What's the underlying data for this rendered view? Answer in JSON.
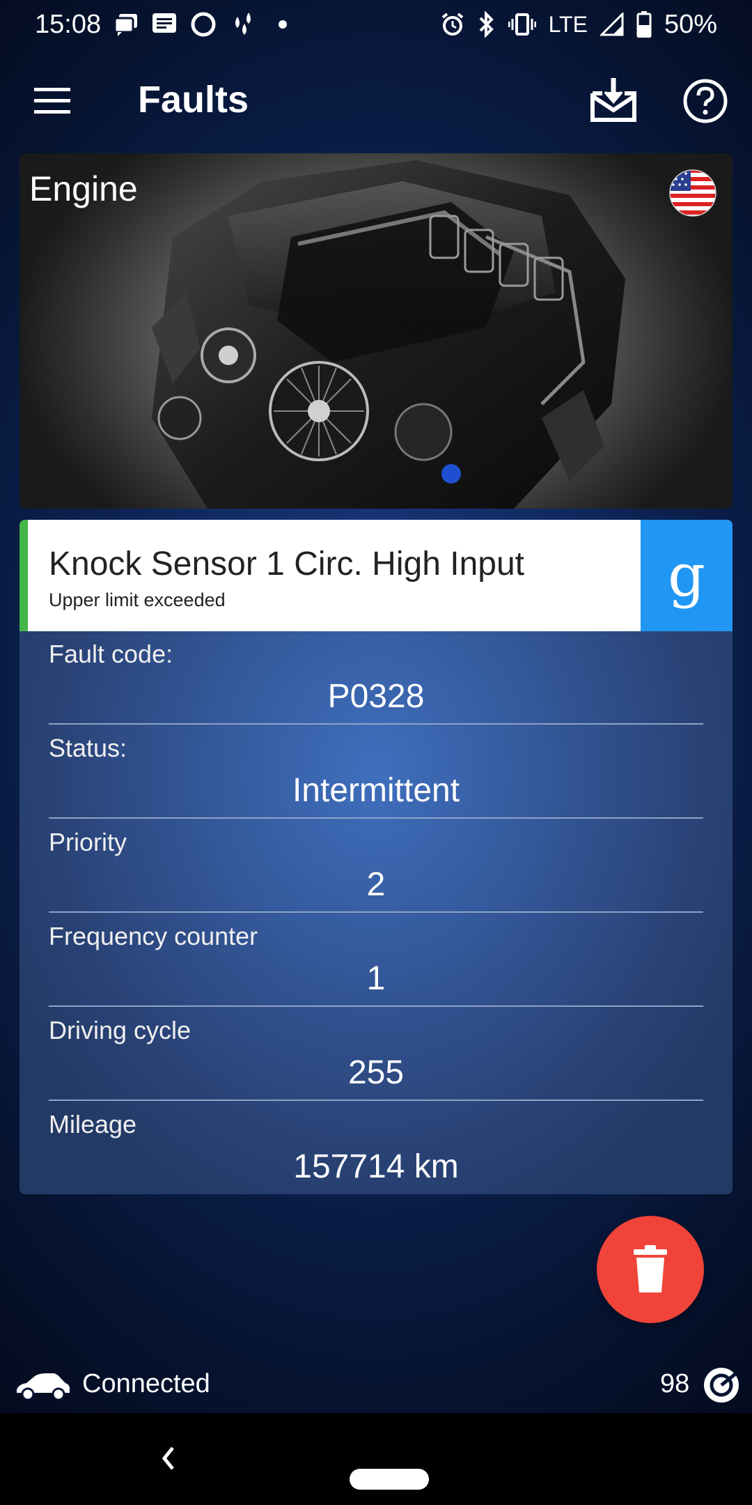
{
  "status_bar": {
    "time": "15:08",
    "network": "LTE",
    "battery": "50%",
    "icons": [
      "chat-icon",
      "message-icon",
      "circle-icon",
      "drops-icon",
      "dot-icon",
      "alarm-icon",
      "bluetooth-icon",
      "vibrate-icon",
      "signal-icon",
      "battery-icon"
    ]
  },
  "app_bar": {
    "title": "Faults",
    "icons": [
      "menu-icon",
      "download-icon",
      "help-icon"
    ]
  },
  "engine_card": {
    "title": "Engine",
    "flag": "us-flag-icon"
  },
  "fault": {
    "name": "Knock Sensor 1 Circ. High Input",
    "subtitle": "Upper limit exceeded",
    "search_icon": "g",
    "accent_color": "#43b649",
    "search_color": "#2196f3"
  },
  "details": [
    {
      "label": "Fault code:",
      "value": "P0328"
    },
    {
      "label": "Status:",
      "value": "Intermittent"
    },
    {
      "label": "Priority",
      "value": "2"
    },
    {
      "label": "Frequency counter",
      "value": "1"
    },
    {
      "label": "Driving cycle",
      "value": "255"
    },
    {
      "label": "Mileage",
      "value": "157714 km"
    }
  ],
  "fab": {
    "icon": "trash-icon",
    "color": "#f0433a"
  },
  "connection": {
    "status": "Connected",
    "count": "98"
  }
}
